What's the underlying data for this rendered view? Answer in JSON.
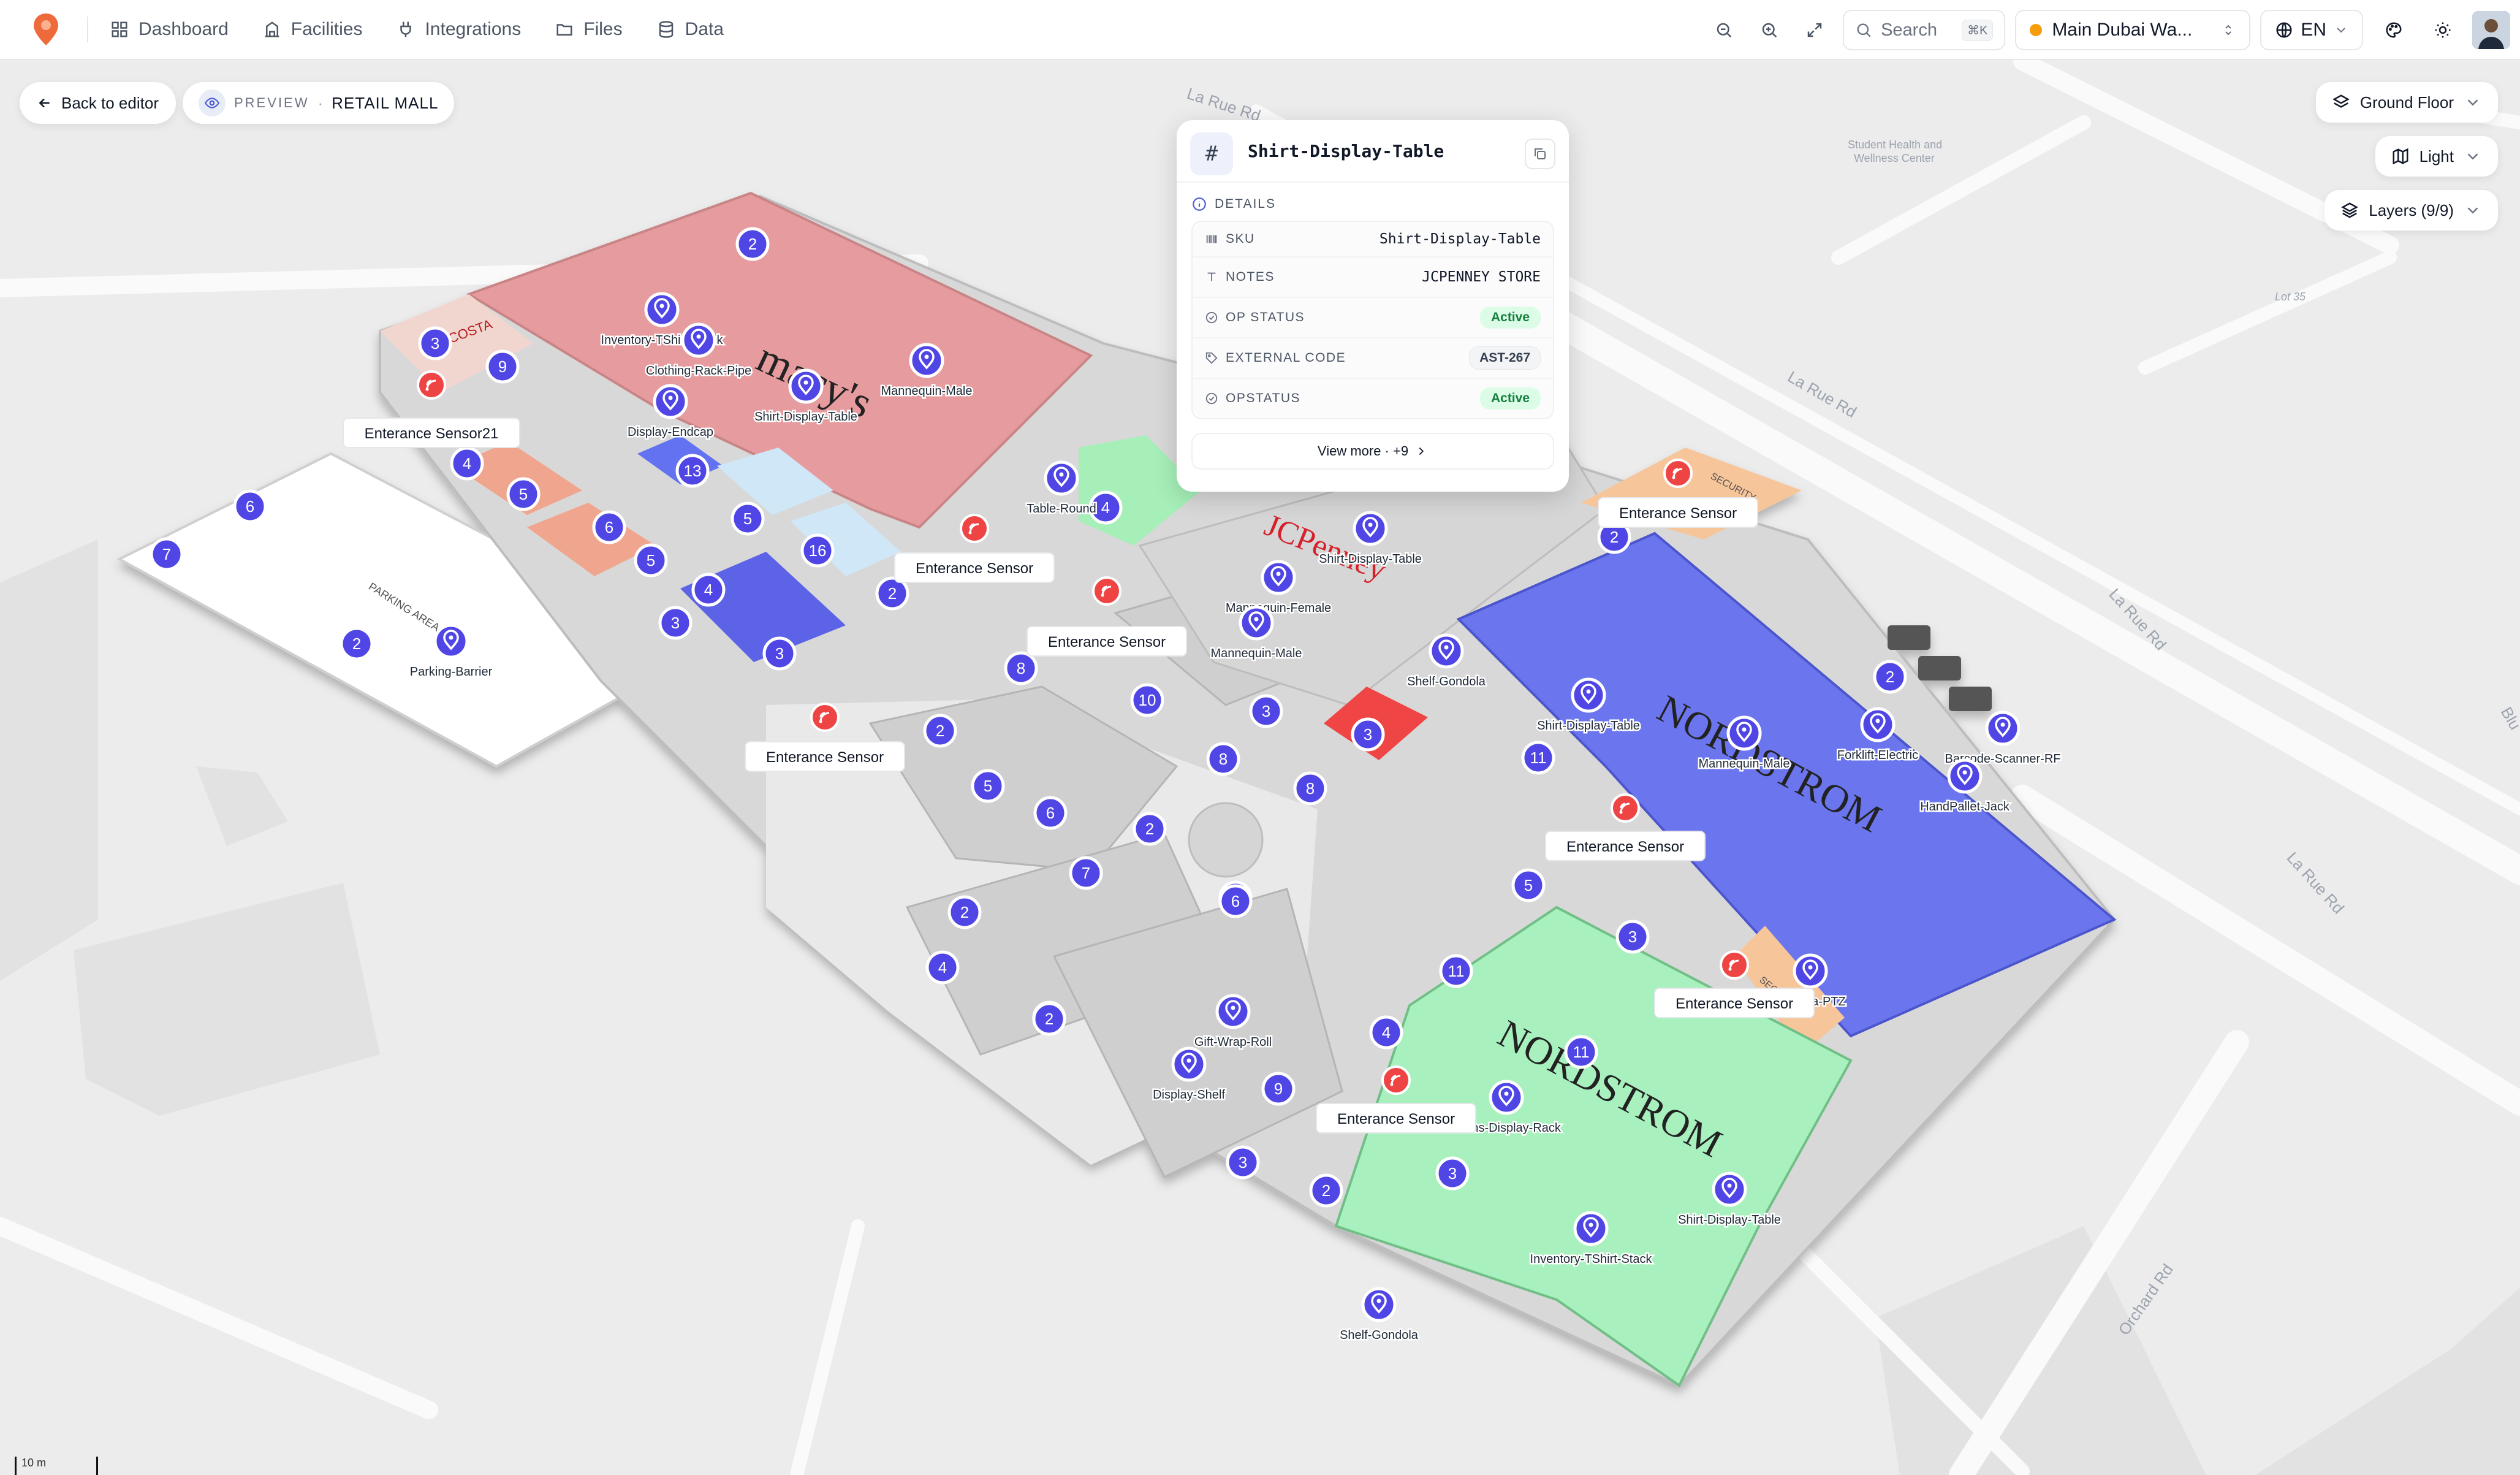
{
  "topbar": {
    "nav": [
      {
        "label": "Dashboard",
        "icon": "grid-icon"
      },
      {
        "label": "Facilities",
        "icon": "building-icon"
      },
      {
        "label": "Integrations",
        "icon": "plug-icon"
      },
      {
        "label": "Files",
        "icon": "folder-icon"
      },
      {
        "label": "Data",
        "icon": "database-icon"
      }
    ],
    "search_label": "Search",
    "search_shortcut": "⌘K",
    "facility": "Main Dubai Wa...",
    "language": "EN"
  },
  "controls": {
    "back_label": "Back to editor",
    "preview_tag": "PREVIEW",
    "preview_sep": "·",
    "preview_name": "RETAIL MALL",
    "floor": "Ground Floor",
    "theme": "Light",
    "layers": "Layers (9/9)"
  },
  "popup": {
    "title": "Shirt-Display-Table",
    "section": "DETAILS",
    "rows": [
      {
        "label": "SKU",
        "value": "Shirt-Display-Table"
      },
      {
        "label": "NOTES",
        "value": "JCPENNEY STORE"
      },
      {
        "label": "OP STATUS",
        "value": "Active"
      },
      {
        "label": "EXTERNAL CODE",
        "value": "AST-267"
      },
      {
        "label": "OPSTATUS",
        "value": "Active"
      }
    ],
    "view_more": "View more · +9"
  },
  "map": {
    "roads": [
      "La Rue Rd",
      "La Rue Rd",
      "La Rue Rd",
      "La Rue Rd",
      "Orchard Rd",
      "Blu"
    ],
    "places": [
      "Student Health and",
      "Wellness Center",
      "Lot 35"
    ],
    "stores": [
      "macy's",
      "JCPenney",
      "NORDSTROM",
      "NORDSTROM",
      "COSTA",
      "PARKING AREA",
      "SECURITY",
      "SECURITY"
    ],
    "sensors": [
      "Enterance Sensor21",
      "Enterance Sensor",
      "Enterance Sensor",
      "Enterance Sensor",
      "Enterance Sensor",
      "Enterance Sensor",
      "Enterance Sensor",
      "Enterance Sensor"
    ],
    "assets": [
      "Inventory-TShirt-Stack",
      "Clothing-Rack-Pipe",
      "Shirt-Display-Table",
      "Mannequin-Male",
      "Display-Endcap",
      "Table-Round",
      "Shirt-Display-Table",
      "Mannequin-Female",
      "Mannequin-Male",
      "Parking-Barrier",
      "Shelf-Gondola",
      "Shirt-Display-Table",
      "Mannequin-Male",
      "Forklift-Electric",
      "Barcode-Scanner-RF",
      "HandPallet-Jack",
      "Camera-PTZ",
      "Gift-Wrap-Roll",
      "Display-Shelf",
      "Jeans-Display-Rack",
      "Shirt-Display-Table",
      "Inventory-TShirt-Stack",
      "Shelf-Gondola"
    ],
    "clusters": [
      "2",
      "3",
      "9",
      "4",
      "5",
      "6",
      "7",
      "13",
      "6",
      "5",
      "4",
      "3",
      "2",
      "3",
      "5",
      "16",
      "2",
      "4",
      "8",
      "10",
      "3",
      "8",
      "2",
      "5",
      "6",
      "2",
      "7",
      "6",
      "2",
      "4",
      "2",
      "9",
      "3",
      "2",
      "4",
      "11",
      "3",
      "8",
      "11",
      "5",
      "3",
      "11",
      "2",
      "2",
      "3",
      "6",
      "2"
    ],
    "scale": "10 m"
  }
}
